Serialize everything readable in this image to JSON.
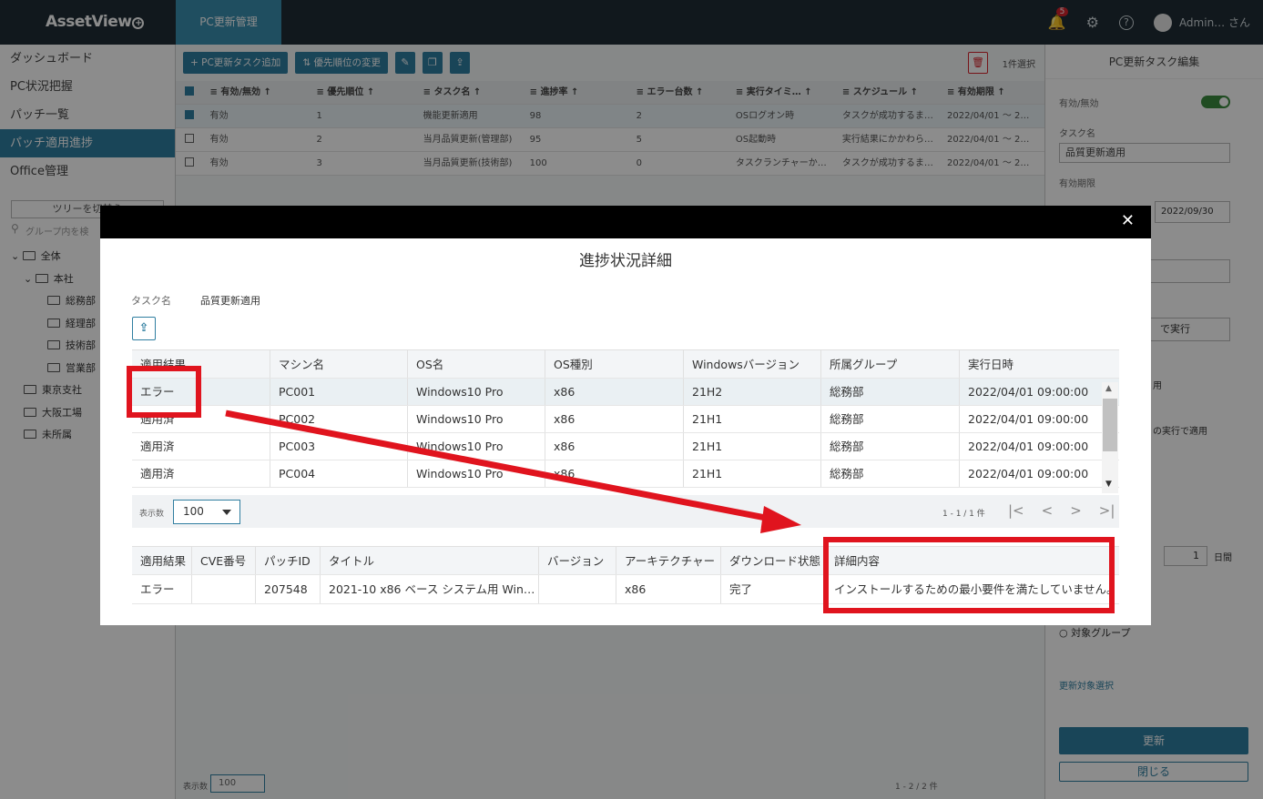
{
  "app": {
    "logo": "AssetView",
    "top_tab": "PC更新管理",
    "notification_count": "5",
    "user": "Admin… さん"
  },
  "sidebar": {
    "items": [
      {
        "label": "ダッシュボード",
        "active": false
      },
      {
        "label": "PC状況把握",
        "active": false
      },
      {
        "label": "パッチ一覧",
        "active": false
      },
      {
        "label": "パッチ適用進捗",
        "active": true
      },
      {
        "label": "Office管理",
        "active": false
      }
    ],
    "tree_button": "ツリーを切替え",
    "tree_search_placeholder": "グループ内を検",
    "tree": [
      {
        "label": "全体",
        "level": 0
      },
      {
        "label": "本社",
        "level": 1
      },
      {
        "label": "総務部",
        "level": 2
      },
      {
        "label": "経理部",
        "level": 2
      },
      {
        "label": "技術部",
        "level": 2
      },
      {
        "label": "営業部",
        "level": 2
      },
      {
        "label": "東京支社",
        "level": 1
      },
      {
        "label": "大阪工場",
        "level": 1
      },
      {
        "label": "未所属",
        "level": 1
      }
    ]
  },
  "main": {
    "toolbar": {
      "add_task": "+ PC更新タスク追加",
      "priority": "⇅ 優先順位の変更",
      "selected_count": "1件選択"
    },
    "columns": [
      "有効/無効",
      "優先順位",
      "タスク名",
      "進捗率",
      "エラー台数",
      "実行タイミ…",
      "スケジュール",
      "有効期限"
    ],
    "rows": [
      [
        "有効",
        "1",
        "機能更新適用",
        "98",
        "2",
        "OSログオン時",
        "タスクが成功するま…",
        "2022/04/01 ～ 2…"
      ],
      [
        "有効",
        "2",
        "当月品質更新(管理部)",
        "95",
        "5",
        "OS起動時",
        "実行結果にかかわら…",
        "2022/04/01 ～ 2…"
      ],
      [
        "有効",
        "3",
        "当月品質更新(技術部)",
        "100",
        "0",
        "タスクランチャーか…",
        "タスクが成功するま…",
        "2022/04/01 ～ 2…"
      ]
    ],
    "footer_label": "表示数",
    "footer_value": "100",
    "footer_info": "1 - 2 / 2 件"
  },
  "right_panel": {
    "title": "PC更新タスク編集",
    "enabled_label": "有効/無効",
    "task_name_label": "タスク名",
    "task_name_value": "品質更新適用",
    "expiry_label": "有効期限",
    "expiry_end": "2022/09/30",
    "run_option": "で実行",
    "apply_note": "用",
    "next_run_note": "の実行で適用",
    "days_value": "1",
    "days_unit": "日間",
    "target_group": "対象グループ",
    "target_select": "更新対象選択",
    "update_button": "更新",
    "close_button": "閉じる"
  },
  "modal": {
    "title": "進捗状況詳細",
    "task_label": "タスク名",
    "task_value": "品質更新適用",
    "columns": [
      "適用結果",
      "マシン名",
      "OS名",
      "OS種別",
      "Windowsバージョン",
      "所属グループ",
      "実行日時"
    ],
    "rows": [
      [
        "エラー",
        "PC001",
        "Windows10 Pro",
        "x86",
        "21H2",
        "総務部",
        "2022/04/01 09:00:00"
      ],
      [
        "適用済",
        "PC002",
        "Windows10 Pro",
        "x86",
        "21H1",
        "総務部",
        "2022/04/01 09:00:00"
      ],
      [
        "適用済",
        "PC003",
        "Windows10 Pro",
        "x86",
        "21H1",
        "総務部",
        "2022/04/01 09:00:00"
      ],
      [
        "適用済",
        "PC004",
        "Windows10 Pro",
        "x86",
        "21H1",
        "総務部",
        "2022/04/01 09:00:00"
      ]
    ],
    "pager": {
      "label": "表示数",
      "page_size": "100",
      "info": "1 - 1 / 1 件"
    },
    "detail_columns": [
      "適用結果",
      "CVE番号",
      "パッチID",
      "タイトル",
      "バージョン",
      "アーキテクチャー",
      "ダウンロード状態",
      "詳細内容"
    ],
    "detail_rows": [
      [
        "エラー",
        "",
        "207548",
        "2021-10 x86 ベース システム用 Win…",
        "",
        "x86",
        "完了",
        "インストールするための最小要件を満たしていません。"
      ]
    ]
  },
  "annotation_color": "#e0141e"
}
